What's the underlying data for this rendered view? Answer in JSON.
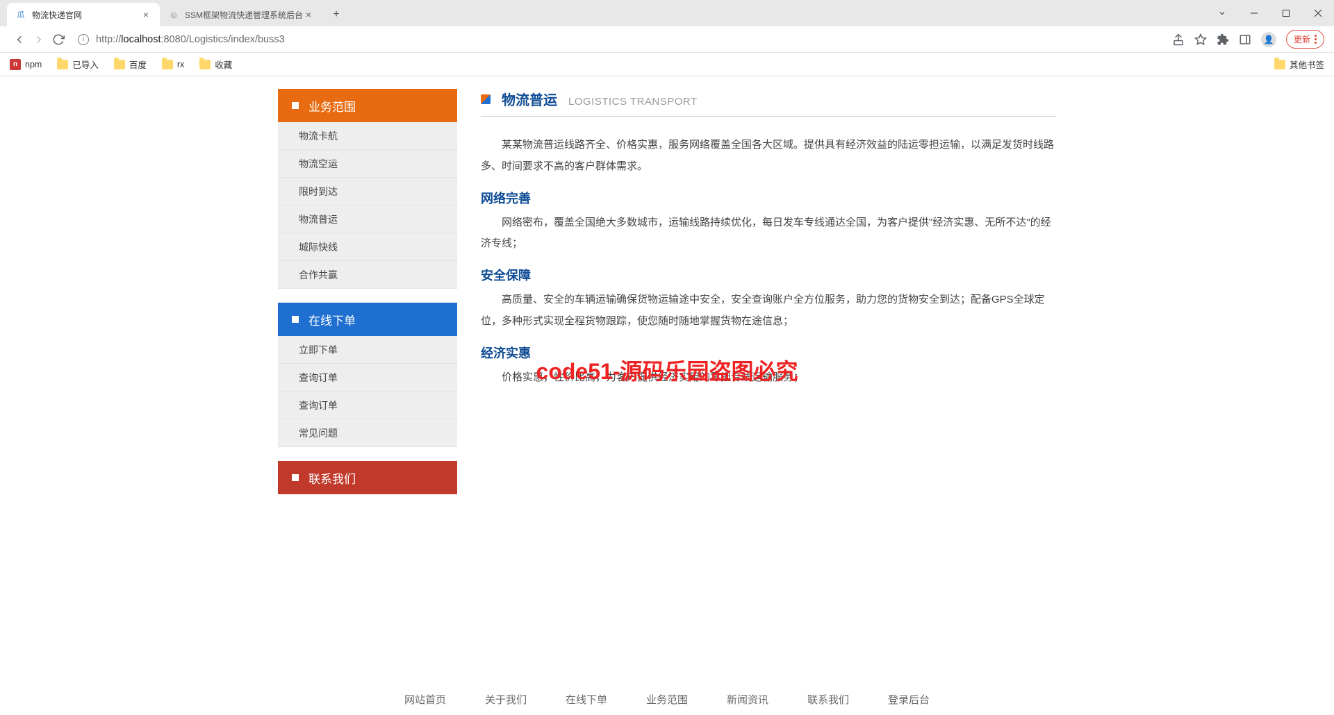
{
  "browser": {
    "tabs": [
      {
        "title": "物流快递官网",
        "active": true,
        "favicon_text": "瓜"
      },
      {
        "title": "SSM框架物流快递管理系统后台",
        "active": false,
        "favicon_text": "◎"
      }
    ],
    "url_host": "localhost",
    "url_port": ":8080",
    "url_path": "/Logistics/index/buss3",
    "url_scheme": "http://",
    "update_label": "更新"
  },
  "bookmarks": {
    "items": [
      "npm",
      "已导入",
      "百度",
      "rx",
      "收藏"
    ],
    "other": "其他书签"
  },
  "sidebar": {
    "blocks": [
      {
        "title": "业务范围",
        "color": "orange",
        "items": [
          "物流卡航",
          "物流空运",
          "限时到达",
          "物流普运",
          "城际快线",
          "合作共赢"
        ]
      },
      {
        "title": "在线下单",
        "color": "blue",
        "items": [
          "立即下单",
          "查询订单",
          "查询订单",
          "常见问题"
        ]
      },
      {
        "title": "联系我们",
        "color": "red",
        "items": []
      }
    ]
  },
  "main": {
    "title_zh": "物流普运",
    "title_en": "LOGISTICS TRANSPORT",
    "intro": "某某物流普运线路齐全、价格实惠，服务网络覆盖全国各大区域。提供具有经济效益的陆运零担运输，以满足发货时线路多、时间要求不高的客户群体需求。",
    "sections": [
      {
        "h": "网络完善",
        "p": "网络密布，覆盖全国绝大多数城市，运输线路持续优化，每日发车专线通达全国，为客户提供\"经济实惠、无所不达\"的经济专线；"
      },
      {
        "h": "安全保障",
        "p": "高质量、安全的车辆运输确保货物运输途中安全，安全查询账户全方位服务，助力您的货物安全到达；配备GPS全球定位，多种形式实现全程货物跟踪，使您随时随地掌握货物在途信息；"
      },
      {
        "h": "经济实惠",
        "p": "价格实惠，性价比高，为客户提供经济实用的零担专线运输服务；"
      }
    ]
  },
  "watermark": "code51-源码乐园盗图必究",
  "footer": [
    "网站首页",
    "关于我们",
    "在线下单",
    "业务范围",
    "新闻资讯",
    "联系我们",
    "登录后台"
  ]
}
